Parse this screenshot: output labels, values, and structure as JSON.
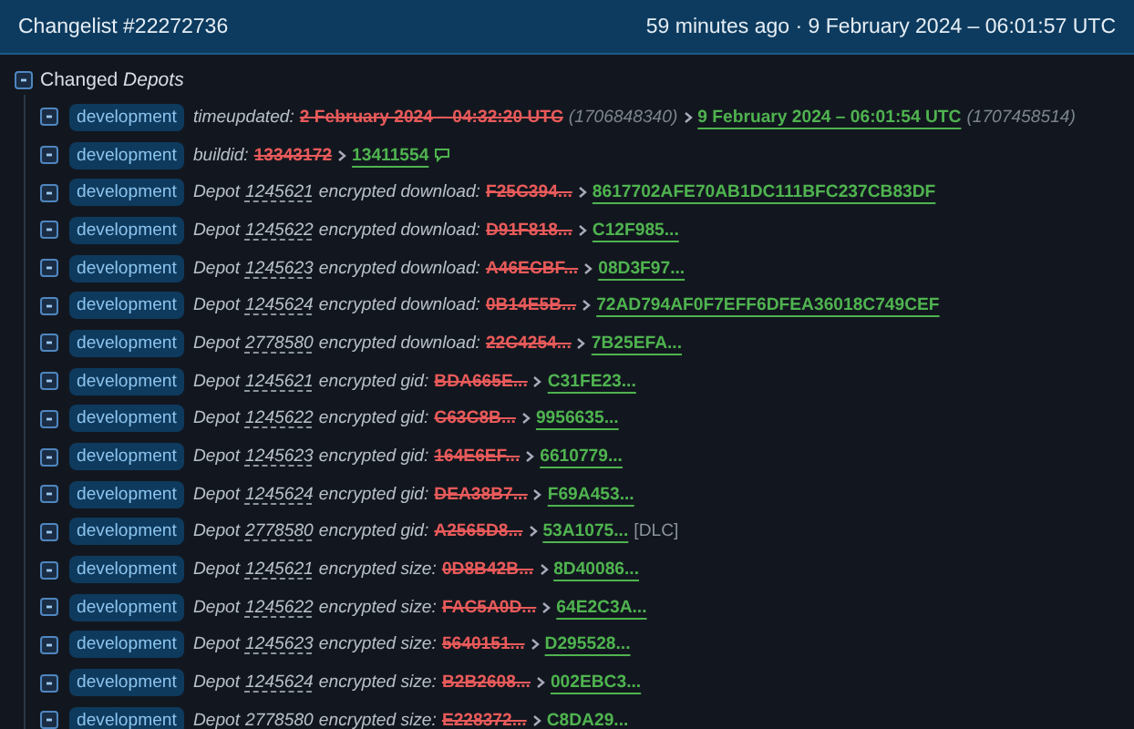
{
  "header": {
    "title": "Changelist #22272736",
    "time": "59 minutes ago · 9 February 2024 – 06:01:57 UTC"
  },
  "tree": {
    "label": "Changed *Depots*",
    "expanded": true,
    "rows": [
      {
        "kind": "time",
        "tag": "development",
        "label": "timeupdated:",
        "old": "2 February 2024 – 04:32:20 UTC",
        "old_extra": "(1706848340)",
        "new": "9 February 2024 – 06:01:54 UTC",
        "new_extra": "(1707458514)"
      },
      {
        "kind": "build",
        "tag": "development",
        "label": "buildid:",
        "old": "13343172",
        "new": "13411554"
      },
      {
        "kind": "depot",
        "tag": "development",
        "label": "Depot",
        "depot": "1245621",
        "field": "encrypted download:",
        "old": "F25C394...",
        "new": "8617702AFE70AB1DC111BFC237CB83DF"
      },
      {
        "kind": "depot",
        "tag": "development",
        "label": "Depot",
        "depot": "1245622",
        "field": "encrypted download:",
        "old": "D91F818...",
        "new": "C12F985..."
      },
      {
        "kind": "depot",
        "tag": "development",
        "label": "Depot",
        "depot": "1245623",
        "field": "encrypted download:",
        "old": "A46ECBF...",
        "new": "08D3F97..."
      },
      {
        "kind": "depot",
        "tag": "development",
        "label": "Depot",
        "depot": "1245624",
        "field": "encrypted download:",
        "old": "0B14E5B...",
        "new": "72AD794AF0F7EFF6DFEA36018C749CEF"
      },
      {
        "kind": "depot",
        "tag": "development",
        "label": "Depot",
        "depot": "2778580",
        "field": "encrypted download:",
        "old": "22C4254...",
        "new": "7B25EFA..."
      },
      {
        "kind": "depot",
        "tag": "development",
        "label": "Depot",
        "depot": "1245621",
        "field": "encrypted gid:",
        "old": "BDA665E...",
        "new": "C31FE23..."
      },
      {
        "kind": "depot",
        "tag": "development",
        "label": "Depot",
        "depot": "1245622",
        "field": "encrypted gid:",
        "old": "C63C8B...",
        "new": "9956635..."
      },
      {
        "kind": "depot",
        "tag": "development",
        "label": "Depot",
        "depot": "1245623",
        "field": "encrypted gid:",
        "old": "164E6EF...",
        "new": "6610779..."
      },
      {
        "kind": "depot",
        "tag": "development",
        "label": "Depot",
        "depot": "1245624",
        "field": "encrypted gid:",
        "old": "DEA38B7...",
        "new": "F69A453..."
      },
      {
        "kind": "depot",
        "tag": "development",
        "label": "Depot",
        "depot": "2778580",
        "field": "encrypted gid:",
        "old": "A2565D8...",
        "new": "53A1075...",
        "note": "[DLC]"
      },
      {
        "kind": "depot",
        "tag": "development",
        "label": "Depot",
        "depot": "1245621",
        "field": "encrypted size:",
        "old": "0D8B42B...",
        "new": "8D40086..."
      },
      {
        "kind": "depot",
        "tag": "development",
        "label": "Depot",
        "depot": "1245622",
        "field": "encrypted size:",
        "old": "FAC5A0D...",
        "new": "64E2C3A..."
      },
      {
        "kind": "depot",
        "tag": "development",
        "label": "Depot",
        "depot": "1245623",
        "field": "encrypted size:",
        "old": "5640151...",
        "new": "D295528..."
      },
      {
        "kind": "depot",
        "tag": "development",
        "label": "Depot",
        "depot": "1245624",
        "field": "encrypted size:",
        "old": "B2B2608...",
        "new": "002EBC3..."
      },
      {
        "kind": "depot",
        "tag": "development",
        "label": "Depot",
        "depot": "2778580",
        "field": "encrypted size:",
        "old": "E228372...",
        "new": "C8DA29..."
      }
    ]
  }
}
